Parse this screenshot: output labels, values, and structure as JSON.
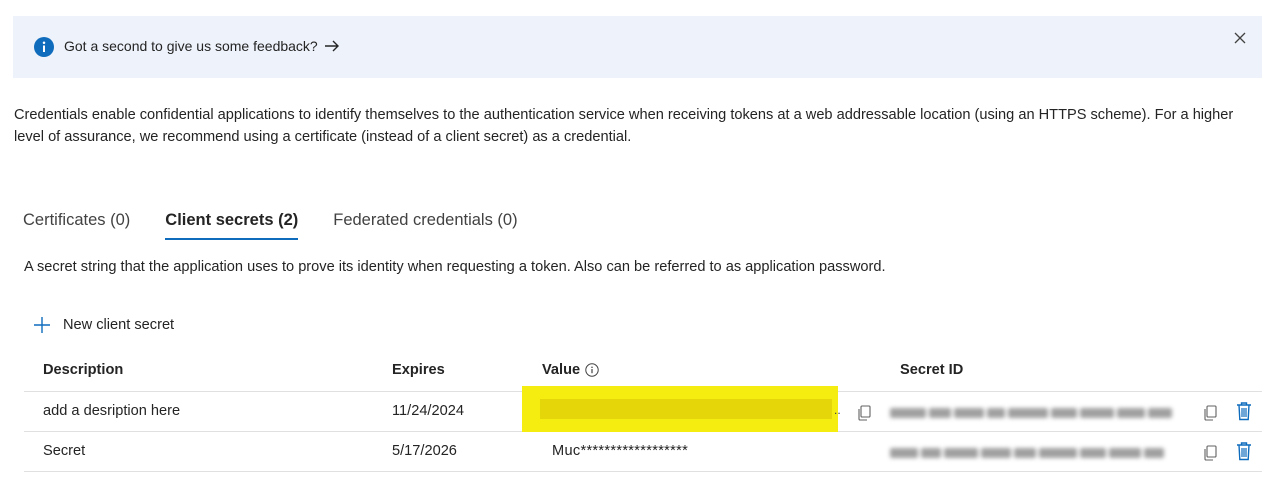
{
  "banner": {
    "message": "Got a second to give us some feedback?",
    "info_icon": "info-icon",
    "arrow_icon": "arrow-right-icon",
    "close_icon": "close-icon"
  },
  "description": "Credentials enable confidential applications to identify themselves to the authentication service when receiving tokens at a web addressable location (using an HTTPS scheme). For a higher level of assurance, we recommend using a certificate (instead of a client secret) as a credential.",
  "tabs": [
    {
      "label": "Certificates (0)",
      "active": false
    },
    {
      "label": "Client secrets (2)",
      "active": true
    },
    {
      "label": "Federated credentials (0)",
      "active": false
    }
  ],
  "subtitle": "A secret string that the application uses to prove its identity when requesting a token. Also can be referred to as application password.",
  "new_secret_label": "New client secret",
  "table": {
    "columns": [
      "Description",
      "Expires",
      "Value",
      "Secret ID"
    ],
    "rows": [
      {
        "description": "add a desription here",
        "expires": "11/24/2024",
        "value": "",
        "ellipsis": "..",
        "secret_id": ""
      },
      {
        "description": "Secret",
        "expires": "5/17/2026",
        "value": "Muc******************",
        "secret_id": ""
      }
    ]
  },
  "colors": {
    "accent": "#0f6cbd",
    "banner_bg": "#eef2fa",
    "highlight": "#f6ed10",
    "delete": "#0f6cbd"
  }
}
